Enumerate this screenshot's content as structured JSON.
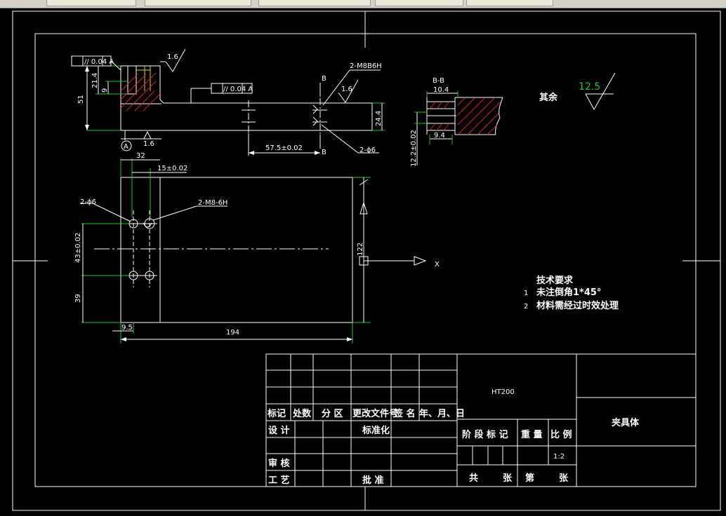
{
  "drawing": {
    "annotations": {
      "flatness_frame_1": "// 0.04 A",
      "flatness_frame_2": "// 0.04 A",
      "rough_1": "1.6",
      "rough_2": "1.6",
      "rough_3": "1.6",
      "dim_51": "51",
      "dim_21_4": "21.4",
      "dim_9": "9",
      "label_b_top": "B",
      "label_b_bottom": "B",
      "m8_label_top": "2-M8B6H",
      "dim_24_4": "24.4",
      "dim_57_5": "57.5±0.02",
      "hole_label_top": "2-ϕ6",
      "datum_a": "A",
      "section_title": "B-B",
      "dim_10_4": "10.4",
      "dim_9_4": "9.4",
      "dim_12_2": "12.2±0.02",
      "rest_label": "其余",
      "rest_value": "12.5",
      "dim_32": "32",
      "dim_15": "15±0.02",
      "hole_label_plan": "2-ϕ6",
      "m8_label_plan": "2-M8-6H",
      "dim_43": "43±0.02",
      "dim_39": "39",
      "dim_122": "122",
      "dim_9_5": "9.5",
      "dim_194": "194",
      "axis_x": "X"
    },
    "tech_req": {
      "title": "技术要求",
      "item1_no": "1",
      "item1": "未注倒角1*45°",
      "item2_no": "2",
      "item2": "材料需经过时效处理"
    },
    "title_block": {
      "material": "HT200",
      "part_name": "夹具体",
      "col_mark": "标记",
      "col_count": "处数",
      "col_zone": "分 区",
      "col_doc": "更改文件号",
      "col_sign": "签 名",
      "col_date": "年、月、日",
      "design": "设 计",
      "standard": "标准化",
      "review": "审 核",
      "process": "工 艺",
      "approve": "批 准",
      "stage": "阶 段 标 记",
      "weight": "重 量",
      "scale_label": "比 例",
      "scale": "1:2",
      "total": "共",
      "sheet_unit": "张",
      "sheet_no": "第",
      "sheet_unit2": "张"
    }
  }
}
